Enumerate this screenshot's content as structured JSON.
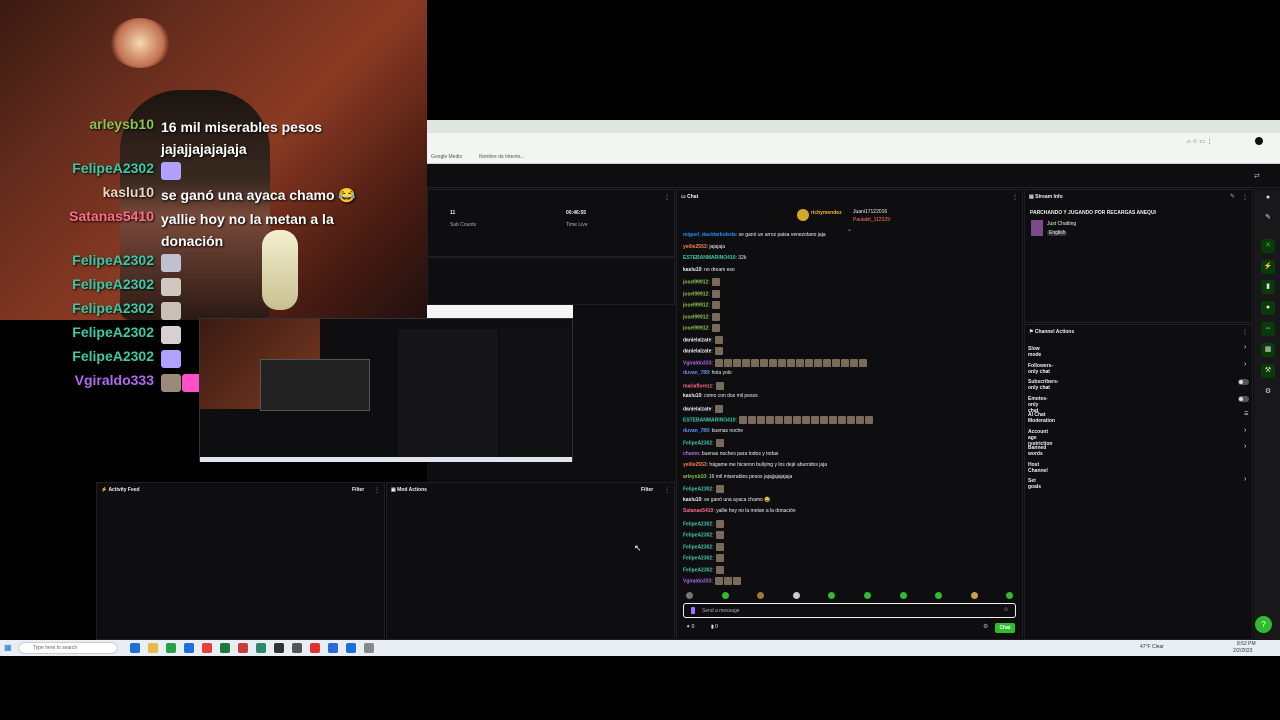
{
  "overlay_chat": [
    {
      "user": "arleysb10",
      "color": "#8bc34a",
      "message": "16 mil miserables pesos jajajjajajajaja"
    },
    {
      "user": "FelipeA2302",
      "color": "#3ec9a7",
      "message": ""
    },
    {
      "user": "kaslu10",
      "color": "#e8d5c0",
      "message": "se ganó una ayaca chamo 😂"
    },
    {
      "user": "Satanas5410",
      "color": "#ff6b8a",
      "message": "yallie hoy no la metan a la donación"
    },
    {
      "user": "FelipeA2302",
      "color": "#3ec9a7",
      "message": ""
    },
    {
      "user": "FelipeA2302",
      "color": "#3ec9a7",
      "message": ""
    },
    {
      "user": "FelipeA2302",
      "color": "#3ec9a7",
      "message": ""
    },
    {
      "user": "FelipeA2302",
      "color": "#3ec9a7",
      "message": ""
    },
    {
      "user": "FelipeA2302",
      "color": "#3ec9a7",
      "message": ""
    },
    {
      "user": "Vgiraldo333",
      "color": "#b069f0",
      "message": ""
    }
  ],
  "browser": {
    "bookmarks": [
      "Google Medio",
      "Nombre de Interés..."
    ]
  },
  "stats": {
    "sub_count_value": "11",
    "sub_count_label": "Sub Counts",
    "time_live_value": "00:46:55",
    "time_live_label": "Time Live"
  },
  "panels": {
    "activity_feed": "Activity Feed",
    "mod_actions": "Mod Actions",
    "filter": "Filter",
    "chat": "Chat",
    "stream_info": "Stream Info",
    "channel_actions": "Channel Actions"
  },
  "chat_header": {
    "top_user": "richymendez",
    "gifters": [
      "Juani17122016",
      "Paulakit_112329"
    ]
  },
  "chat_lines": [
    {
      "user": "miguel_davidarboleda",
      "color": "#1e90ff",
      "text": "se ganó un arroz paisa venezolano jaja"
    },
    {
      "user": "yeilie2553",
      "color": "#ff7f50",
      "text": "jajajaja"
    },
    {
      "user": "ESTEBANMARINO410",
      "color": "#3ec9a7",
      "text": "32k"
    },
    {
      "user": "kaslu10",
      "color": "#efeff1",
      "text": "no dream eso"
    },
    {
      "user": "josel99912",
      "color": "#8bc34a",
      "text": ""
    },
    {
      "user": "josel99912",
      "color": "#8bc34a",
      "text": ""
    },
    {
      "user": "josel99912",
      "color": "#8bc34a",
      "text": ""
    },
    {
      "user": "josel99912",
      "color": "#8bc34a",
      "text": ""
    },
    {
      "user": "josel99912",
      "color": "#8bc34a",
      "text": ""
    },
    {
      "user": "danielalzate",
      "color": "#efeff1",
      "text": ""
    },
    {
      "user": "danielalzate",
      "color": "#efeff1",
      "text": ""
    },
    {
      "user": "Vgiraldo333",
      "color": "#b069f0",
      "text": ""
    },
    {
      "user": "duvan_789",
      "color": "#5f8fff",
      "text": "hola yolo"
    },
    {
      "user": "mariaflorezz",
      "color": "#ff6b8a",
      "text": ""
    },
    {
      "user": "kaslu10",
      "color": "#efeff1",
      "text": "como con dos mil pesos"
    },
    {
      "user": "danielalzate",
      "color": "#efeff1",
      "text": ""
    },
    {
      "user": "ESTEBANMARINO410",
      "color": "#3ec9a7",
      "text": ""
    },
    {
      "user": "duvan_789",
      "color": "#5f8fff",
      "text": "buenas noche"
    },
    {
      "user": "FelipeA2302",
      "color": "#3ec9a7",
      "text": ""
    },
    {
      "user": "chamo",
      "color": "#b069f0",
      "text": "buenas noches para todos y todas"
    },
    {
      "user": "yeilie2553",
      "color": "#ff7f50",
      "text": "hágame me hicieron bullying y los dejé aburridos jaja"
    },
    {
      "user": "arleysb10",
      "color": "#8bc34a",
      "text": "16 mil miserables pesos jajajjajajajaja"
    },
    {
      "user": "FelipeA2302",
      "color": "#3ec9a7",
      "text": ""
    },
    {
      "user": "kaslu10",
      "color": "#efeff1",
      "text": "se ganó una ayaca chamo 😂"
    },
    {
      "user": "Satanas5410",
      "color": "#ff6b8a",
      "text": "yallie hoy no la metan a la donación"
    },
    {
      "user": "FelipeA2302",
      "color": "#3ec9a7",
      "text": ""
    },
    {
      "user": "FelipeA2302",
      "color": "#3ec9a7",
      "text": ""
    },
    {
      "user": "FelipeA2302",
      "color": "#3ec9a7",
      "text": ""
    },
    {
      "user": "FelipeA2302",
      "color": "#3ec9a7",
      "text": ""
    },
    {
      "user": "FelipeA2302",
      "color": "#3ec9a7",
      "text": ""
    },
    {
      "user": "Vgiraldo333",
      "color": "#b069f0",
      "text": ""
    }
  ],
  "chat_input": {
    "placeholder": "Send a message",
    "points": "0",
    "bits": "0",
    "chat_button": "Chat"
  },
  "stream_info": {
    "title": "PARCHANDO Y JUGANDO POR RECARGAS ANEQUI",
    "category": "Just Chatting",
    "language": "English"
  },
  "channel_actions": [
    {
      "label": "Slow mode",
      "control": "arrow"
    },
    {
      "label": "Followers-only chat",
      "control": "arrow"
    },
    {
      "label": "Subscribers-only chat",
      "control": "toggle"
    },
    {
      "label": "Emotes-only chat",
      "control": "toggle"
    },
    {
      "label": "AI Chat Moderation",
      "control": "icon"
    },
    {
      "label": "Account age restriction",
      "control": "arrow"
    },
    {
      "label": "Banned words",
      "control": "arrow"
    },
    {
      "label": "Host Channel",
      "control": "none"
    },
    {
      "label": "Set goals",
      "control": "arrow"
    }
  ],
  "taskbar": {
    "search_placeholder": "Type here to search",
    "weather": "47°F Clear",
    "time": "8:52 PM",
    "date": "2/2/2023"
  },
  "colors": {
    "twitch_bg": "#0e0e10",
    "accent_green": "#2fbd2f"
  }
}
